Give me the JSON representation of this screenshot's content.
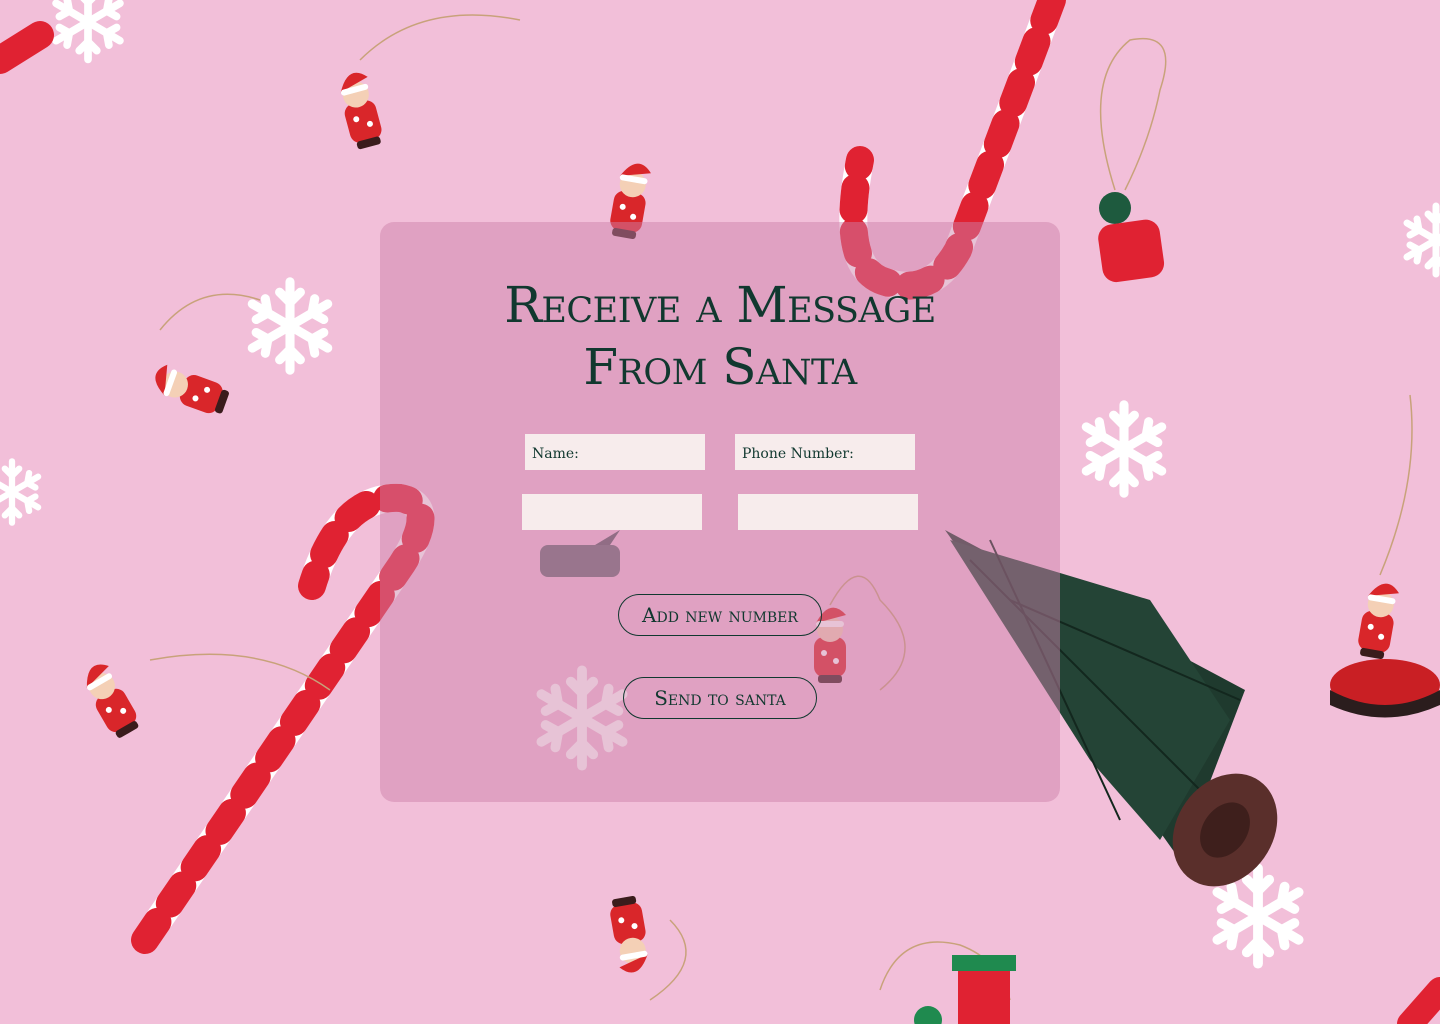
{
  "page": {
    "title_line1": "Receive a Message",
    "title_line2": "From Santa"
  },
  "form": {
    "name_label": "Name:",
    "phone_label": "Phone Number:",
    "name_value": "",
    "phone_value": ""
  },
  "actions": {
    "add_label": "Add new number",
    "send_label": "Send to santa"
  },
  "colors": {
    "background": "#f2bfd9",
    "card": "#cd82aa",
    "text": "#11382f",
    "field": "#f7ecec",
    "candy_red": "#e02232",
    "tree_green": "#1f3a2e"
  },
  "icons": [
    "snowflake-icon",
    "candy-cane-icon",
    "ornament-icon",
    "christmas-tree-icon"
  ]
}
